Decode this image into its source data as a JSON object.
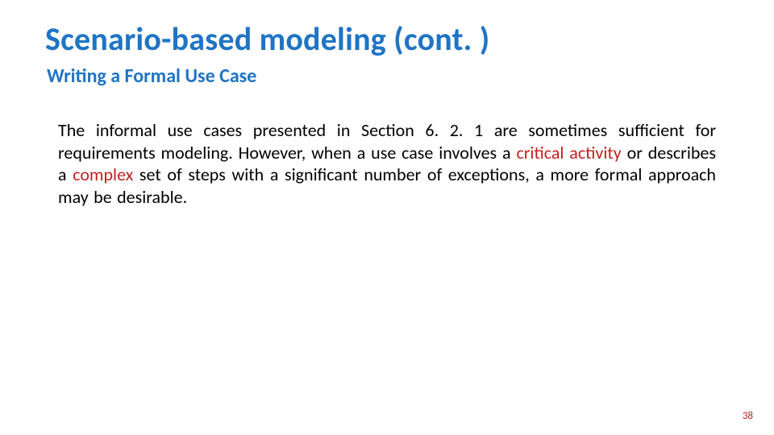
{
  "title": "Scenario-based modeling (cont. )",
  "subtitle": "Writing a Formal Use Case",
  "body": {
    "p1a": "The  informal  use  cases  presented  in  Section  6. 2. 1  are  sometimes sufficient  for requirements  modeling.  However,  when  a  use  case involves  a ",
    "hl1": "critical  activity ",
    "p1b": " or describes a ",
    "hl2": "complex ",
    "p1c": "set of steps with a significant number of exceptions, a more formal approach may be desirable."
  },
  "pageNumber": "38"
}
